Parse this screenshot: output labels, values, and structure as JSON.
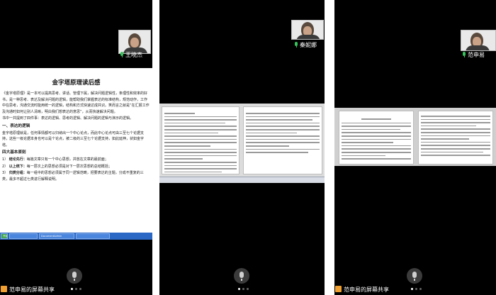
{
  "panel1": {
    "participant_name": "王晓杰",
    "document_title": "金字塔原理读后感",
    "paragraphs": [
      "《金字塔原理》是一本可以提高思考、讲话、管理下属，解决问题逻辑性，条理性和效率的好书，是一种思考、表达及解决问题的逻辑，能帮助我们掌握表达的标准结构，规范动作，工作中在思考，沟通交流时能用统一的逻辑，结构和方式快速达成共识。笑而言之就是“在汇报工作及沟通时如何让别人清晰，明白我们想表达的意思”，从而快速解决问题。",
      "书中一共提到了四件事：表达的逻辑、思考的逻辑、解决问题的逻辑与演示的逻辑。"
    ],
    "section_heading": "一、表达的逻辑",
    "section_paragraph": "金字塔原理就是，任何事情都可以归纳出一个中心论点，而此中心论点可由三至七个论据支持，这些一级论据本身也可以是个论点，被二级的三至七个论据支持，如此延伸，状如金字塔。",
    "rules_heading": "四大基本原则",
    "rules": [
      {
        "num": "1）",
        "label": "结论先行：",
        "text": "每篇文章只有一个中心思想，并放在文章的最前面；"
      },
      {
        "num": "2）",
        "label": "以上统下：",
        "text": "每一层次上的思想必须是对下一层次思想的总结概括；"
      },
      {
        "num": "3）",
        "label": "归类分组：",
        "text": "每一组中的思想必须属于同一逻辑范畴，把要表达的主题，分成不重复的三类，最多不超过七类进行解释说明。"
      }
    ],
    "taskbar_items": [
      "开始",
      "",
      "DocumentAdmin",
      ""
    ]
  },
  "panel2": {
    "participant_name": "秦妮娜"
  },
  "panel3": {
    "participant_name": "范申易"
  },
  "share_label": "范申易的屏幕共享"
}
